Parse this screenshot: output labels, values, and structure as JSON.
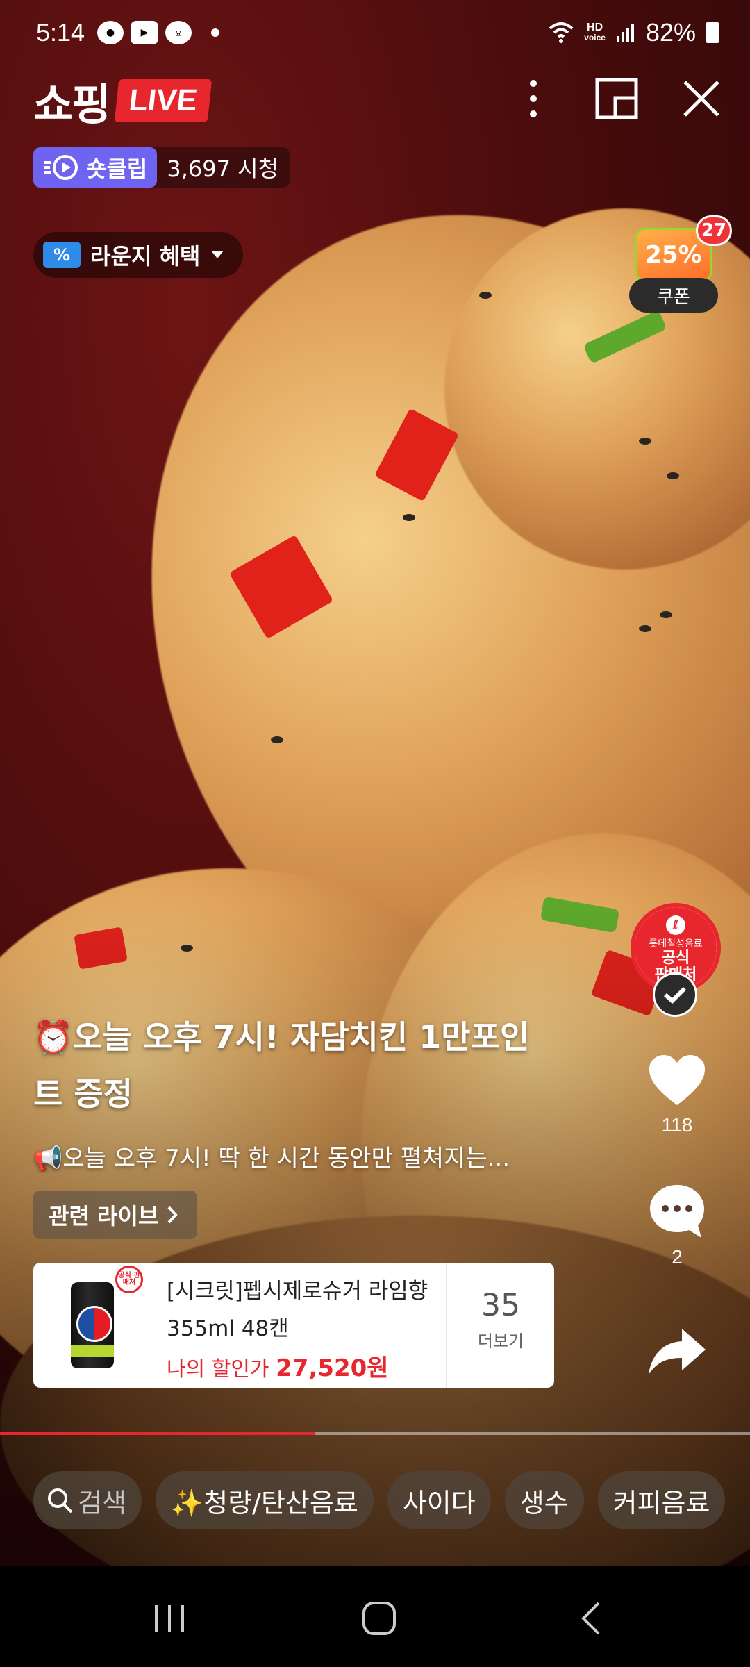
{
  "status_bar": {
    "time": "5:14",
    "icons": [
      "messenger-icon",
      "youtube-icon",
      "yogiyo-icon",
      "dot-icon"
    ],
    "hd_line1": "HD",
    "hd_line2": "voice",
    "battery": "82%"
  },
  "header": {
    "logo_text": "쇼핑",
    "logo_live": "LIVE"
  },
  "clip": {
    "badge_label": "숏클립",
    "views": "3,697 시청"
  },
  "lounge": {
    "label": "라운지 혜택"
  },
  "coupon": {
    "percent": "25%",
    "count": "27",
    "label": "쿠폰"
  },
  "seller": {
    "brand": "롯데칠성음료",
    "title_line1": "공식",
    "title_line2": "판매처"
  },
  "actions": {
    "like_count": "118",
    "comment_count": "2"
  },
  "content": {
    "title": "⏰오늘 오후 7시! 자담치킨 1만포인트 증정",
    "description": "📢오늘 오후 7시! 딱 한 시간 동안만 펼쳐지는...",
    "related_label": "관련 라이브"
  },
  "product": {
    "badge": "공식 판매처",
    "name": "[시크릿]펩시제로슈거 라임향 355ml 48캔",
    "price_label": "나의 할인가",
    "price_value": "27,520원",
    "more_count": "35",
    "more_label": "더보기"
  },
  "progress": {
    "fraction": 0.42
  },
  "chips": [
    {
      "label": "검색"
    },
    {
      "label": "✨청량/탄산음료"
    },
    {
      "label": "사이다"
    },
    {
      "label": "생수"
    },
    {
      "label": "커피음료"
    }
  ],
  "colors": {
    "accent": "#e8262d",
    "clip_badge": "#6f63f2"
  }
}
